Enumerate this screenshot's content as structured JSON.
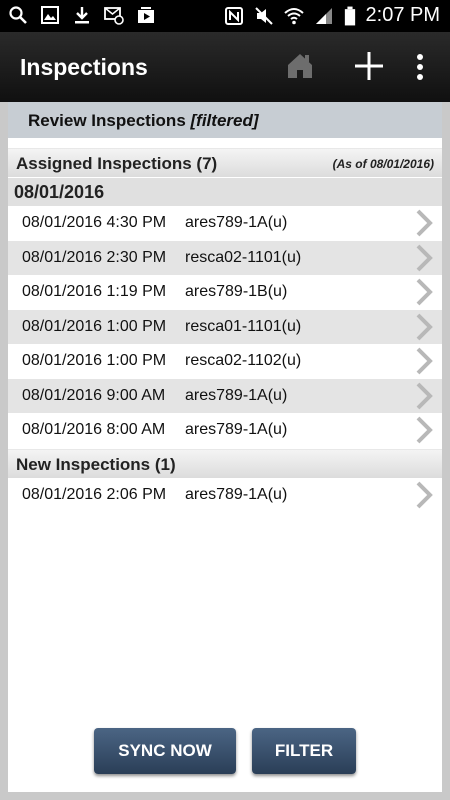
{
  "status_bar": {
    "left_icons": [
      "search-icon",
      "image-icon",
      "download-icon",
      "email-sync-icon",
      "media-icon"
    ],
    "right_icons": [
      "nfc-icon",
      "mute-icon",
      "wifi-icon",
      "signal-icon",
      "battery-icon"
    ],
    "time": "2:07 PM"
  },
  "app_bar": {
    "title": "Inspections",
    "actions": [
      "home-icon",
      "add-icon",
      "more-vert-icon"
    ]
  },
  "review": {
    "title": "Review Inspections",
    "filter_note": "[filtered]"
  },
  "assigned": {
    "title": "Assigned Inspections (7)",
    "as_of": "(As of 08/01/2016)",
    "date_group": "08/01/2016",
    "rows": [
      {
        "datetime": "08/01/2016 4:30 PM",
        "id": "ares789-1A(u)"
      },
      {
        "datetime": "08/01/2016 2:30 PM",
        "id": "resca02-1101(u)"
      },
      {
        "datetime": "08/01/2016 1:19 PM",
        "id": "ares789-1B(u)"
      },
      {
        "datetime": "08/01/2016 1:00 PM",
        "id": "resca01-1101(u)"
      },
      {
        "datetime": "08/01/2016 1:00 PM",
        "id": "resca02-1102(u)"
      },
      {
        "datetime": "08/01/2016 9:00 AM",
        "id": "ares789-1A(u)"
      },
      {
        "datetime": "08/01/2016 8:00 AM",
        "id": "ares789-1A(u)"
      }
    ]
  },
  "new": {
    "title": "New Inspections (1)",
    "rows": [
      {
        "datetime": "08/01/2016 2:06 PM",
        "id": "ares789-1A(u)"
      }
    ]
  },
  "buttons": {
    "sync": "SYNC NOW",
    "filter": "FILTER"
  },
  "colors": {
    "button": "#3a5170",
    "review_header": "#c7cdd3",
    "row_alt": "#e4e4e4",
    "app_bar": "#1a1a1a"
  }
}
